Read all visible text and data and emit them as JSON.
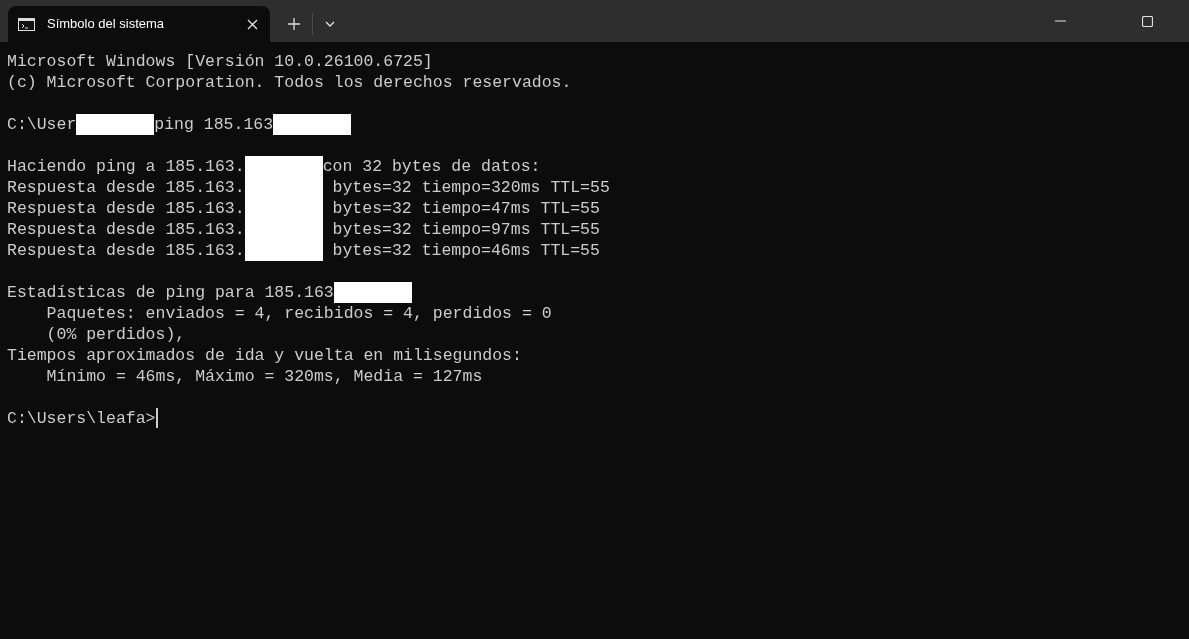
{
  "tab": {
    "title": "Símbolo del sistema",
    "selected": true
  },
  "lines": [
    {
      "kind": "text",
      "segments": [
        {
          "kind": "text",
          "text": "Microsoft Windows [Versión 10.0.26100.6725]"
        }
      ]
    },
    {
      "kind": "text",
      "segments": [
        {
          "kind": "text",
          "text": "(c) Microsoft Corporation. Todos los derechos reservados."
        }
      ]
    },
    {
      "kind": "blank"
    },
    {
      "kind": "text",
      "segments": [
        {
          "kind": "text",
          "text": "C:\\User"
        },
        {
          "kind": "redacted"
        },
        {
          "kind": "text",
          "text": "ping 185.163"
        },
        {
          "kind": "redacted"
        }
      ]
    },
    {
      "kind": "blank"
    },
    {
      "kind": "text",
      "segments": [
        {
          "kind": "text",
          "text": "Haciendo ping a 185.163."
        },
        {
          "kind": "redacted"
        },
        {
          "kind": "text",
          "text": "con 32 bytes de datos:"
        }
      ]
    },
    {
      "kind": "text",
      "segments": [
        {
          "kind": "text",
          "text": "Respuesta desde 185.163."
        },
        {
          "kind": "redacted"
        },
        {
          "kind": "text",
          "text": " bytes=32 tiempo=320ms TTL=55"
        }
      ]
    },
    {
      "kind": "text",
      "segments": [
        {
          "kind": "text",
          "text": "Respuesta desde 185.163."
        },
        {
          "kind": "redacted"
        },
        {
          "kind": "text",
          "text": " bytes=32 tiempo=47ms TTL=55"
        }
      ]
    },
    {
      "kind": "text",
      "segments": [
        {
          "kind": "text",
          "text": "Respuesta desde 185.163."
        },
        {
          "kind": "redacted"
        },
        {
          "kind": "text",
          "text": " bytes=32 tiempo=97ms TTL=55"
        }
      ]
    },
    {
      "kind": "text",
      "segments": [
        {
          "kind": "text",
          "text": "Respuesta desde 185.163."
        },
        {
          "kind": "redacted"
        },
        {
          "kind": "text",
          "text": " bytes=32 tiempo=46ms TTL=55"
        }
      ]
    },
    {
      "kind": "blank"
    },
    {
      "kind": "text",
      "segments": [
        {
          "kind": "text",
          "text": "Estadísticas de ping para 185.163"
        },
        {
          "kind": "redacted"
        }
      ]
    },
    {
      "kind": "text",
      "segments": [
        {
          "kind": "text",
          "text": "    Paquetes: enviados = 4, recibidos = 4, perdidos = 0"
        }
      ]
    },
    {
      "kind": "text",
      "segments": [
        {
          "kind": "text",
          "text": "    (0% perdidos),"
        }
      ]
    },
    {
      "kind": "text",
      "segments": [
        {
          "kind": "text",
          "text": "Tiempos aproximados de ida y vuelta en milisegundos:"
        }
      ]
    },
    {
      "kind": "text",
      "segments": [
        {
          "kind": "text",
          "text": "    Mínimo = 46ms, Máximo = 320ms, Media = 127ms"
        }
      ]
    },
    {
      "kind": "blank"
    },
    {
      "kind": "text",
      "segments": [
        {
          "kind": "text",
          "text": "C:\\Users\\leafa>"
        },
        {
          "kind": "cursor"
        }
      ]
    }
  ]
}
